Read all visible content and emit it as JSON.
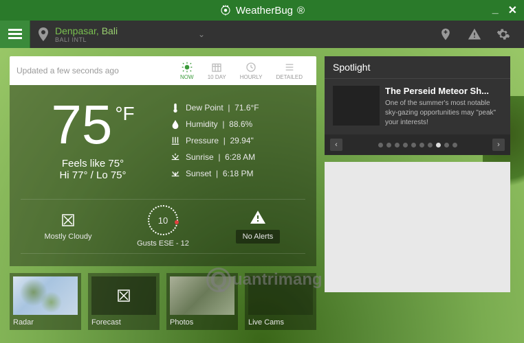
{
  "titlebar": {
    "brand": "WeatherBug"
  },
  "location": {
    "city": "Denpasar,",
    "region": "Bali",
    "station": "BALI INTL"
  },
  "tabs": {
    "updated": "Updated a few seconds ago",
    "now": "NOW",
    "tenday": "10 DAY",
    "hourly": "HOURLY",
    "detailed": "DETAILED"
  },
  "temp": {
    "value": "75",
    "unit": "°F",
    "feels": "Feels like 75°",
    "hilo": "Hi 77° / Lo 75°"
  },
  "details": {
    "dewpoint_label": "Dew Point",
    "dewpoint_value": "71.6°F",
    "humidity_label": "Humidity",
    "humidity_value": "88.6%",
    "pressure_label": "Pressure",
    "pressure_value": "29.94\"",
    "sunrise_label": "Sunrise",
    "sunrise_value": "6:28 AM",
    "sunset_label": "Sunset",
    "sunset_value": "6:18 PM"
  },
  "status": {
    "condition": "Mostly Cloudy",
    "wind_speed": "10",
    "wind_text": "Gusts ESE - 12",
    "alerts": "No Alerts"
  },
  "thumbs": {
    "radar": "Radar",
    "forecast": "Forecast",
    "photos": "Photos",
    "cams": "Live Cams"
  },
  "spotlight": {
    "header": "Spotlight",
    "title": "The Perseid Meteor Sh...",
    "desc": "One of the summer's most notable sky-gazing opportunities may \"peak\" your interests!",
    "dots": 10,
    "active_dot": 7
  },
  "watermark": "uantrimang"
}
